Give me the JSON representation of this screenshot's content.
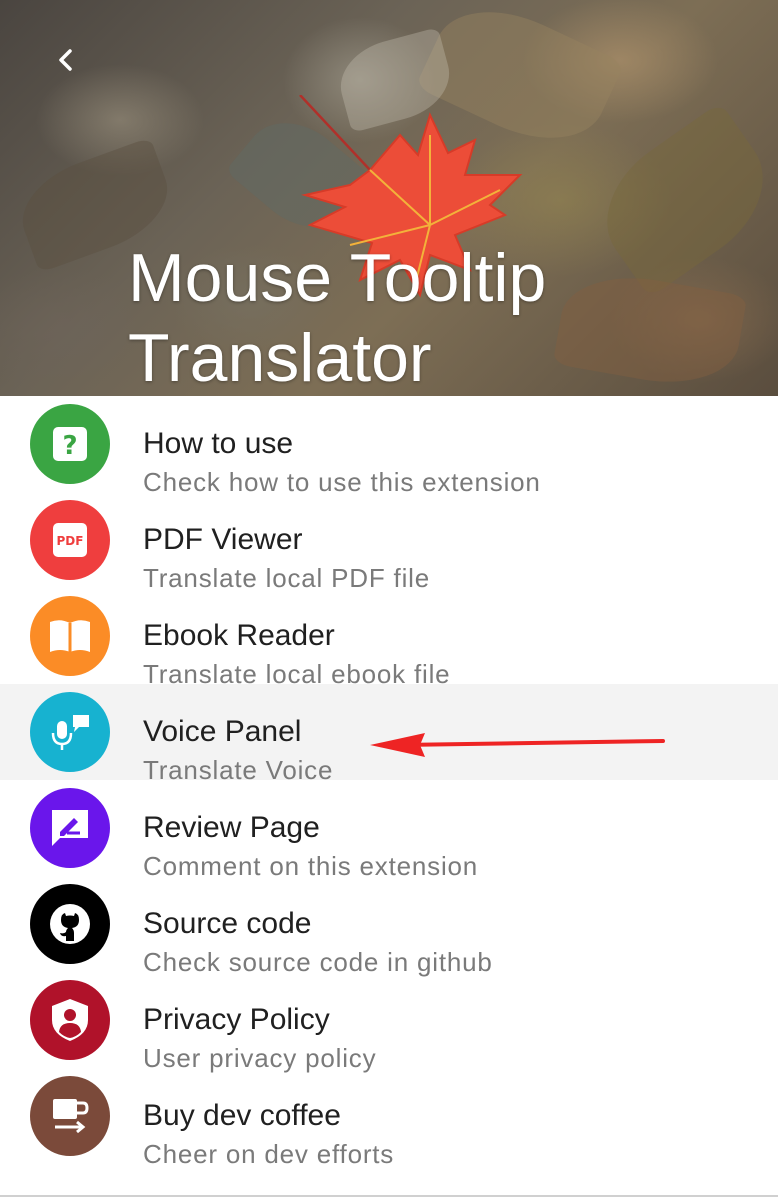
{
  "header": {
    "title_line1": "Mouse Tooltip",
    "title_line2": "Translator",
    "back_icon": "chevron-left-icon"
  },
  "menu": {
    "items": [
      {
        "title": "How to use",
        "subtitle": "Check how to use this extension",
        "icon": "help-icon",
        "color": "#3aa543"
      },
      {
        "title": "PDF Viewer",
        "subtitle": "Translate local PDF file",
        "icon": "pdf-icon",
        "icon_text": "PDF",
        "color": "#ef3e3e"
      },
      {
        "title": "Ebook Reader",
        "subtitle": "Translate local ebook file",
        "icon": "book-icon",
        "color": "#fb8c26"
      },
      {
        "title": "Voice Panel",
        "subtitle": "Translate Voice",
        "icon": "voice-chat-icon",
        "color": "#17b2d0"
      },
      {
        "title": "Review Page",
        "subtitle": "Comment on this extension",
        "icon": "rate-review-icon",
        "color": "#6a16eb"
      },
      {
        "title": "Source code",
        "subtitle": "Check source code in github",
        "icon": "github-icon",
        "color": "#000000"
      },
      {
        "title": "Privacy Policy",
        "subtitle": "User privacy policy",
        "icon": "privacy-shield-icon",
        "color": "#b0122a"
      },
      {
        "title": "Buy dev coffee",
        "subtitle": "Cheer on dev efforts",
        "icon": "coffee-icon",
        "color": "#7b4a3a"
      }
    ],
    "highlighted_index": 3
  },
  "annotation": {
    "arrow_color": "#ee2424",
    "points_to": "Voice Panel"
  }
}
